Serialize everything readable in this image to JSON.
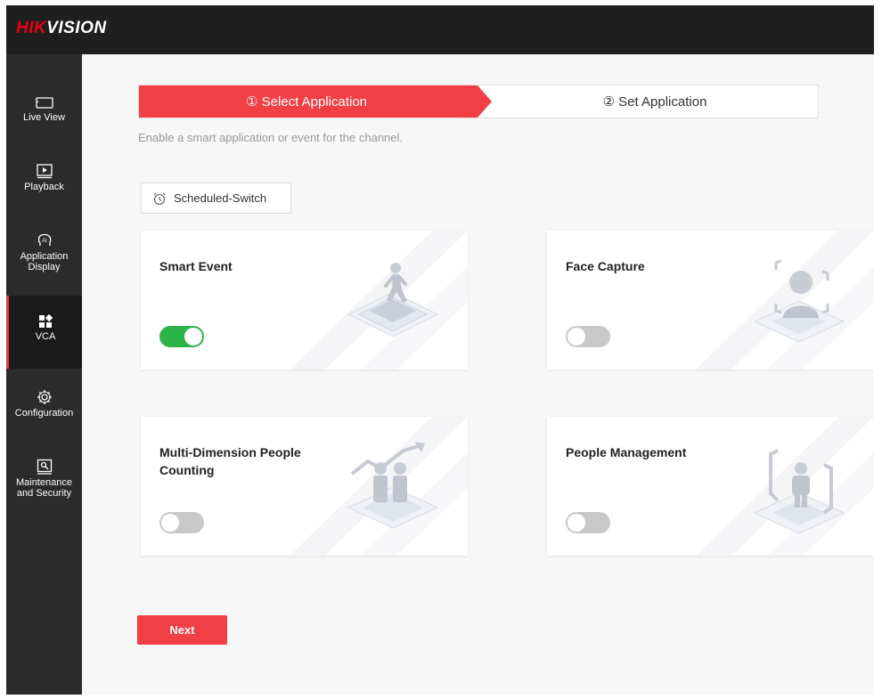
{
  "brand": {
    "logo_red": "HIK",
    "logo_white": "VISION"
  },
  "sidebar": {
    "items": [
      {
        "label": "Live View",
        "icon": "monitor-icon",
        "active": false
      },
      {
        "label": "Playback",
        "icon": "playback-icon",
        "active": false
      },
      {
        "label": "Application\nDisplay",
        "icon": "ai-head-icon",
        "active": false
      },
      {
        "label": "VCA",
        "icon": "vca-grid-icon",
        "active": true
      },
      {
        "label": "Configuration",
        "icon": "gear-icon",
        "active": false
      },
      {
        "label": "Maintenance\nand Security",
        "icon": "maintenance-icon",
        "active": false
      }
    ]
  },
  "steps": {
    "step1": "① Select Application",
    "step2": "② Set Application"
  },
  "hint": "Enable a smart application or event for the channel.",
  "scheduled_switch": {
    "label": "Scheduled-Switch",
    "icon": "alarm-clock-icon"
  },
  "cards": [
    {
      "title": "Smart Event",
      "enabled": true,
      "icon": "walking-person-icon"
    },
    {
      "title": "Face Capture",
      "enabled": false,
      "icon": "face-scan-icon"
    },
    {
      "title": "Multi-Dimension People Counting",
      "enabled": false,
      "icon": "people-counting-icon"
    },
    {
      "title": "People Management",
      "enabled": false,
      "icon": "person-frame-icon"
    }
  ],
  "next_label": "Next",
  "colors": {
    "accent": "#f23f45",
    "toggle_on": "#2cb34a",
    "toggle_off": "#c9c9c9",
    "sidebar_bg": "#2b2b2b",
    "topbar_bg": "#1f1f1f"
  }
}
